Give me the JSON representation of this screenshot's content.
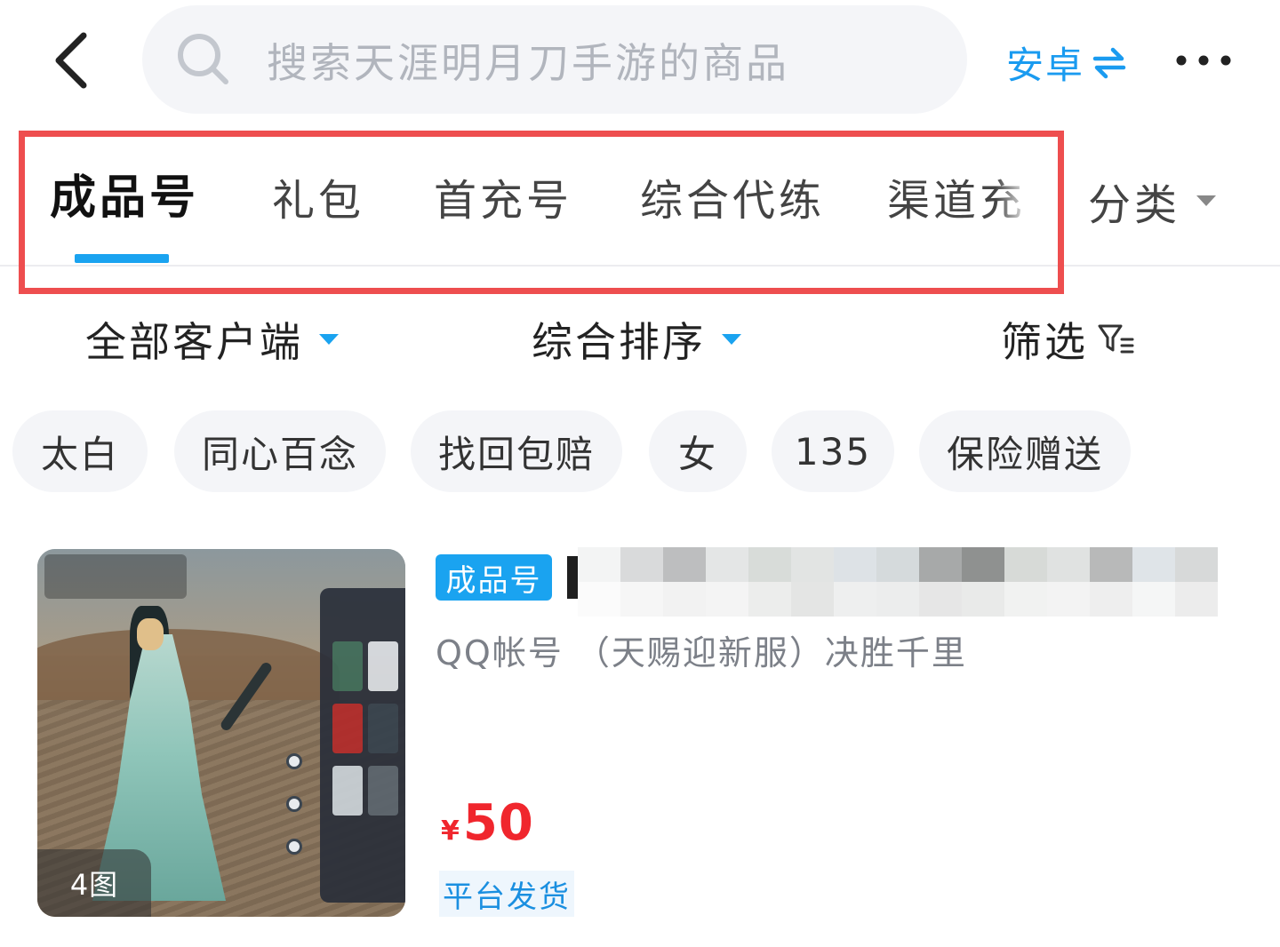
{
  "search": {
    "placeholder": "搜索天涯明月刀手游的商品"
  },
  "header": {
    "os_label": "安卓",
    "os_switch_icon": "swap-arrows-icon",
    "more_icon": "more-dots-icon",
    "back_icon": "chevron-left-icon"
  },
  "tabs": [
    {
      "label": "成品号",
      "active": true
    },
    {
      "label": "礼包",
      "active": false
    },
    {
      "label": "首充号",
      "active": false
    },
    {
      "label": "综合代练",
      "active": false
    },
    {
      "label": "渠道充值",
      "active": false
    }
  ],
  "category": {
    "label": "分类"
  },
  "filters": {
    "client": "全部客户端",
    "sort": "综合排序",
    "filter": "筛选"
  },
  "chips": [
    "太白",
    "同心百念",
    "找回包赔",
    "女",
    "135",
    "保险赠送"
  ],
  "product": {
    "tag": "成品号",
    "subtitle": "QQ帐号 （天赐迎新服）决胜千里",
    "currency": "¥",
    "price": "50",
    "delivery": "平台发货",
    "image_count": "4图"
  },
  "colors": {
    "accent": "#1aa3f0",
    "price": "#f0262d",
    "highlight_border": "#ee4e4f",
    "chip_bg": "#f4f5f8"
  }
}
